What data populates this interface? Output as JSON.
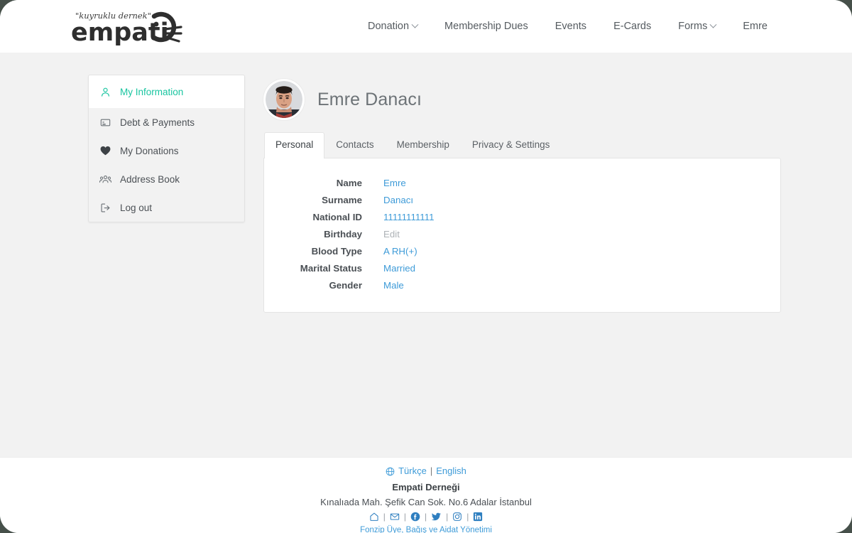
{
  "brand": {
    "tagline": "\"kuyruklu dernek\"",
    "name": "empati",
    "accent_teal": "#19c5a0",
    "link_blue": "#3e9bd8"
  },
  "nav": {
    "items": [
      {
        "label": "Donation",
        "has_caret": true
      },
      {
        "label": "Membership Dues",
        "has_caret": false
      },
      {
        "label": "Events",
        "has_caret": false
      },
      {
        "label": "E-Cards",
        "has_caret": false
      },
      {
        "label": "Forms",
        "has_caret": true
      },
      {
        "label": "Emre",
        "has_caret": false
      }
    ]
  },
  "sidebar": {
    "items": [
      {
        "label": "My Information",
        "icon": "user-icon",
        "active": true
      },
      {
        "label": "Debt & Payments",
        "icon": "card-icon",
        "active": false
      },
      {
        "label": "My Donations",
        "icon": "heart-icon",
        "active": false
      },
      {
        "label": "Address Book",
        "icon": "people-icon",
        "active": false
      },
      {
        "label": "Log out",
        "icon": "logout-icon",
        "active": false
      }
    ]
  },
  "profile": {
    "name": "Emre Danacı"
  },
  "tabs": [
    {
      "label": "Personal",
      "active": true
    },
    {
      "label": "Contacts",
      "active": false
    },
    {
      "label": "Membership",
      "active": false
    },
    {
      "label": "Privacy & Settings",
      "active": false
    }
  ],
  "personal_fields": [
    {
      "label": "Name",
      "value": "Emre",
      "placeholder": false
    },
    {
      "label": "Surname",
      "value": "Danacı",
      "placeholder": false
    },
    {
      "label": "National ID",
      "value": "11111111111",
      "placeholder": false
    },
    {
      "label": "Birthday",
      "value": "Edit",
      "placeholder": true
    },
    {
      "label": "Blood Type",
      "value": "A RH(+)",
      "placeholder": false
    },
    {
      "label": "Marital Status",
      "value": "Married",
      "placeholder": false
    },
    {
      "label": "Gender",
      "value": "Male",
      "placeholder": false
    }
  ],
  "footer": {
    "lang_tr": "Türkçe",
    "lang_sep": "|",
    "lang_en": "English",
    "org_name": "Empati Derneği",
    "org_address": "Kınalıada Mah. Şefik Can Sok. No.6 Adalar İstanbul",
    "socials": [
      {
        "name": "home-icon"
      },
      {
        "name": "email-icon"
      },
      {
        "name": "facebook-icon"
      },
      {
        "name": "twitter-icon"
      },
      {
        "name": "instagram-icon"
      },
      {
        "name": "linkedin-icon"
      }
    ],
    "credit": "Fonzip Üye, Bağış ve Aidat Yönetimi"
  }
}
